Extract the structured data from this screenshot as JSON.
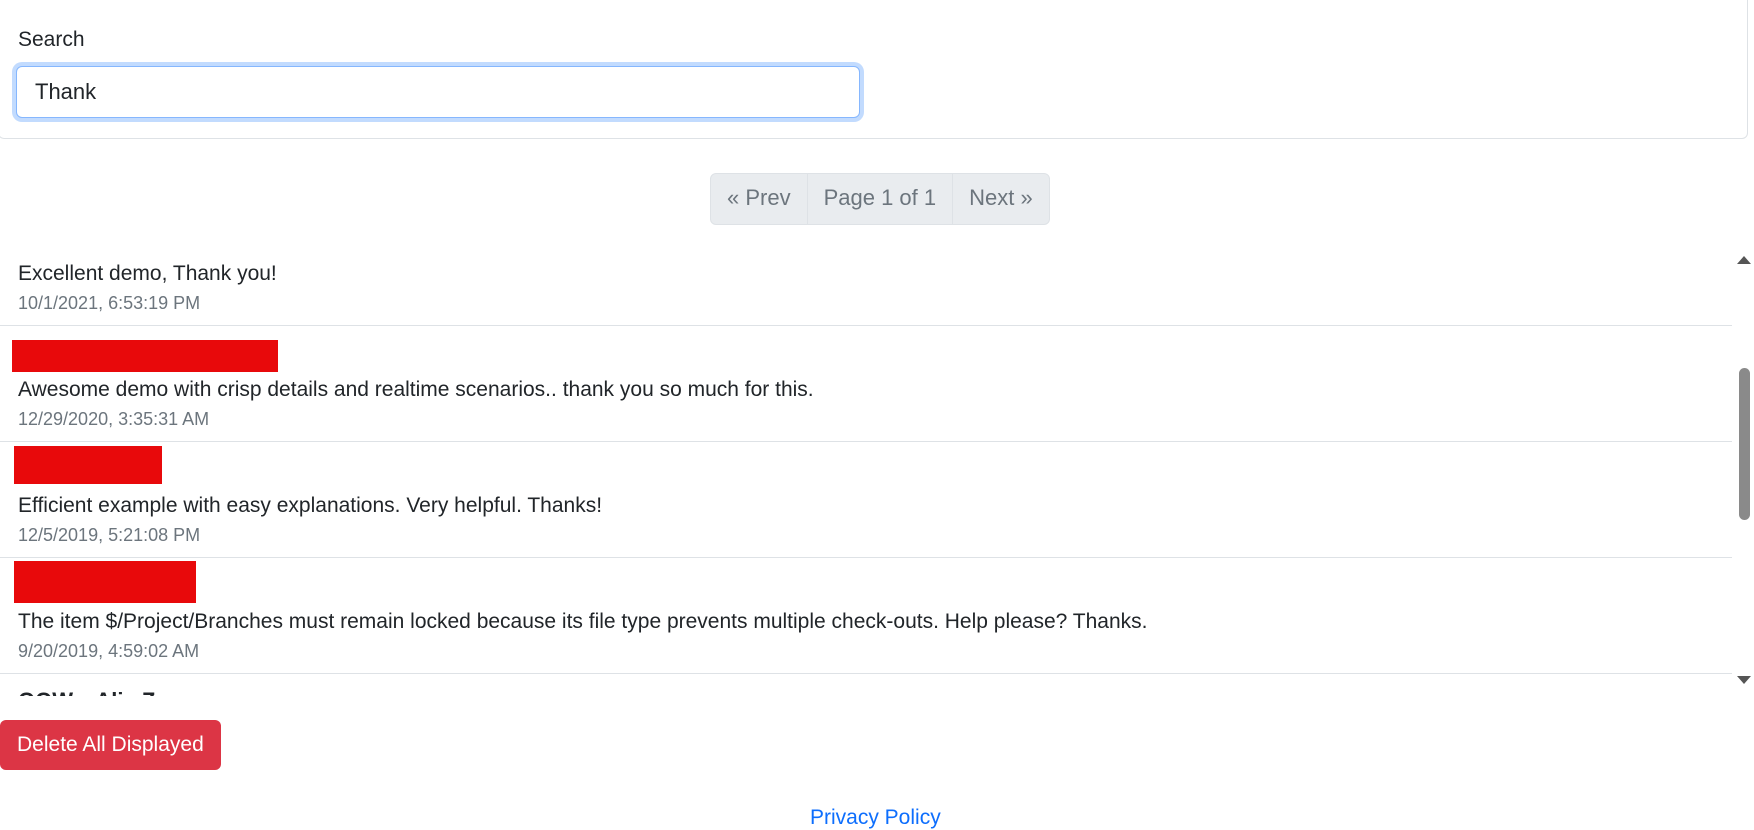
{
  "search": {
    "label": "Search",
    "value": "Thank"
  },
  "pagination": {
    "prev": "« Prev",
    "page": "Page 1 of 1",
    "next": "Next »"
  },
  "comments": [
    {
      "message": "Excellent demo, Thank you!",
      "timestamp": "10/1/2021, 6:53:19 PM"
    },
    {
      "message": "Awesome demo with crisp details and realtime scenarios.. thank you so much for this.",
      "timestamp": "12/29/2020, 3:35:31 AM"
    },
    {
      "message": "Efficient example with easy explanations. Very helpful. Thanks!",
      "timestamp": "12/5/2019, 5:21:08 PM"
    },
    {
      "message": "The item $/Project/Branches must remain locked because its file type prevents multiple check-outs. Help please? Thanks.",
      "timestamp": "9/20/2019, 4:59:02 AM"
    },
    {
      "author": "QQW... Alia Z",
      "message": "",
      "timestamp": ""
    }
  ],
  "actions": {
    "delete_all": "Delete All Displayed"
  },
  "footer": {
    "privacy": "Privacy Policy"
  },
  "colors": {
    "redaction": "#e8090b",
    "danger": "#dc3545",
    "success": "#198754",
    "link": "#0d6efd"
  }
}
